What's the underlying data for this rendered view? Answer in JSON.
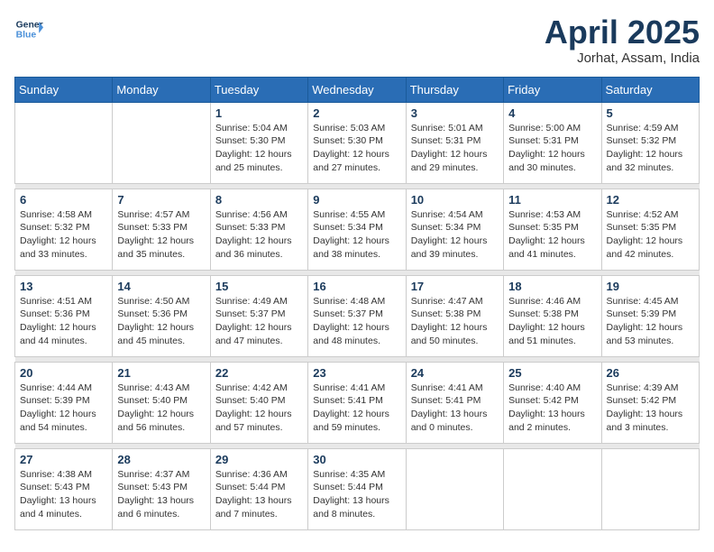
{
  "header": {
    "logo_line1": "General",
    "logo_line2": "Blue",
    "month": "April 2025",
    "location": "Jorhat, Assam, India"
  },
  "days_of_week": [
    "Sunday",
    "Monday",
    "Tuesday",
    "Wednesday",
    "Thursday",
    "Friday",
    "Saturday"
  ],
  "weeks": [
    [
      {
        "day": "",
        "info": ""
      },
      {
        "day": "",
        "info": ""
      },
      {
        "day": "1",
        "info": "Sunrise: 5:04 AM\nSunset: 5:30 PM\nDaylight: 12 hours\nand 25 minutes."
      },
      {
        "day": "2",
        "info": "Sunrise: 5:03 AM\nSunset: 5:30 PM\nDaylight: 12 hours\nand 27 minutes."
      },
      {
        "day": "3",
        "info": "Sunrise: 5:01 AM\nSunset: 5:31 PM\nDaylight: 12 hours\nand 29 minutes."
      },
      {
        "day": "4",
        "info": "Sunrise: 5:00 AM\nSunset: 5:31 PM\nDaylight: 12 hours\nand 30 minutes."
      },
      {
        "day": "5",
        "info": "Sunrise: 4:59 AM\nSunset: 5:32 PM\nDaylight: 12 hours\nand 32 minutes."
      }
    ],
    [
      {
        "day": "6",
        "info": "Sunrise: 4:58 AM\nSunset: 5:32 PM\nDaylight: 12 hours\nand 33 minutes."
      },
      {
        "day": "7",
        "info": "Sunrise: 4:57 AM\nSunset: 5:33 PM\nDaylight: 12 hours\nand 35 minutes."
      },
      {
        "day": "8",
        "info": "Sunrise: 4:56 AM\nSunset: 5:33 PM\nDaylight: 12 hours\nand 36 minutes."
      },
      {
        "day": "9",
        "info": "Sunrise: 4:55 AM\nSunset: 5:34 PM\nDaylight: 12 hours\nand 38 minutes."
      },
      {
        "day": "10",
        "info": "Sunrise: 4:54 AM\nSunset: 5:34 PM\nDaylight: 12 hours\nand 39 minutes."
      },
      {
        "day": "11",
        "info": "Sunrise: 4:53 AM\nSunset: 5:35 PM\nDaylight: 12 hours\nand 41 minutes."
      },
      {
        "day": "12",
        "info": "Sunrise: 4:52 AM\nSunset: 5:35 PM\nDaylight: 12 hours\nand 42 minutes."
      }
    ],
    [
      {
        "day": "13",
        "info": "Sunrise: 4:51 AM\nSunset: 5:36 PM\nDaylight: 12 hours\nand 44 minutes."
      },
      {
        "day": "14",
        "info": "Sunrise: 4:50 AM\nSunset: 5:36 PM\nDaylight: 12 hours\nand 45 minutes."
      },
      {
        "day": "15",
        "info": "Sunrise: 4:49 AM\nSunset: 5:37 PM\nDaylight: 12 hours\nand 47 minutes."
      },
      {
        "day": "16",
        "info": "Sunrise: 4:48 AM\nSunset: 5:37 PM\nDaylight: 12 hours\nand 48 minutes."
      },
      {
        "day": "17",
        "info": "Sunrise: 4:47 AM\nSunset: 5:38 PM\nDaylight: 12 hours\nand 50 minutes."
      },
      {
        "day": "18",
        "info": "Sunrise: 4:46 AM\nSunset: 5:38 PM\nDaylight: 12 hours\nand 51 minutes."
      },
      {
        "day": "19",
        "info": "Sunrise: 4:45 AM\nSunset: 5:39 PM\nDaylight: 12 hours\nand 53 minutes."
      }
    ],
    [
      {
        "day": "20",
        "info": "Sunrise: 4:44 AM\nSunset: 5:39 PM\nDaylight: 12 hours\nand 54 minutes."
      },
      {
        "day": "21",
        "info": "Sunrise: 4:43 AM\nSunset: 5:40 PM\nDaylight: 12 hours\nand 56 minutes."
      },
      {
        "day": "22",
        "info": "Sunrise: 4:42 AM\nSunset: 5:40 PM\nDaylight: 12 hours\nand 57 minutes."
      },
      {
        "day": "23",
        "info": "Sunrise: 4:41 AM\nSunset: 5:41 PM\nDaylight: 12 hours\nand 59 minutes."
      },
      {
        "day": "24",
        "info": "Sunrise: 4:41 AM\nSunset: 5:41 PM\nDaylight: 13 hours\nand 0 minutes."
      },
      {
        "day": "25",
        "info": "Sunrise: 4:40 AM\nSunset: 5:42 PM\nDaylight: 13 hours\nand 2 minutes."
      },
      {
        "day": "26",
        "info": "Sunrise: 4:39 AM\nSunset: 5:42 PM\nDaylight: 13 hours\nand 3 minutes."
      }
    ],
    [
      {
        "day": "27",
        "info": "Sunrise: 4:38 AM\nSunset: 5:43 PM\nDaylight: 13 hours\nand 4 minutes."
      },
      {
        "day": "28",
        "info": "Sunrise: 4:37 AM\nSunset: 5:43 PM\nDaylight: 13 hours\nand 6 minutes."
      },
      {
        "day": "29",
        "info": "Sunrise: 4:36 AM\nSunset: 5:44 PM\nDaylight: 13 hours\nand 7 minutes."
      },
      {
        "day": "30",
        "info": "Sunrise: 4:35 AM\nSunset: 5:44 PM\nDaylight: 13 hours\nand 8 minutes."
      },
      {
        "day": "",
        "info": ""
      },
      {
        "day": "",
        "info": ""
      },
      {
        "day": "",
        "info": ""
      }
    ]
  ]
}
